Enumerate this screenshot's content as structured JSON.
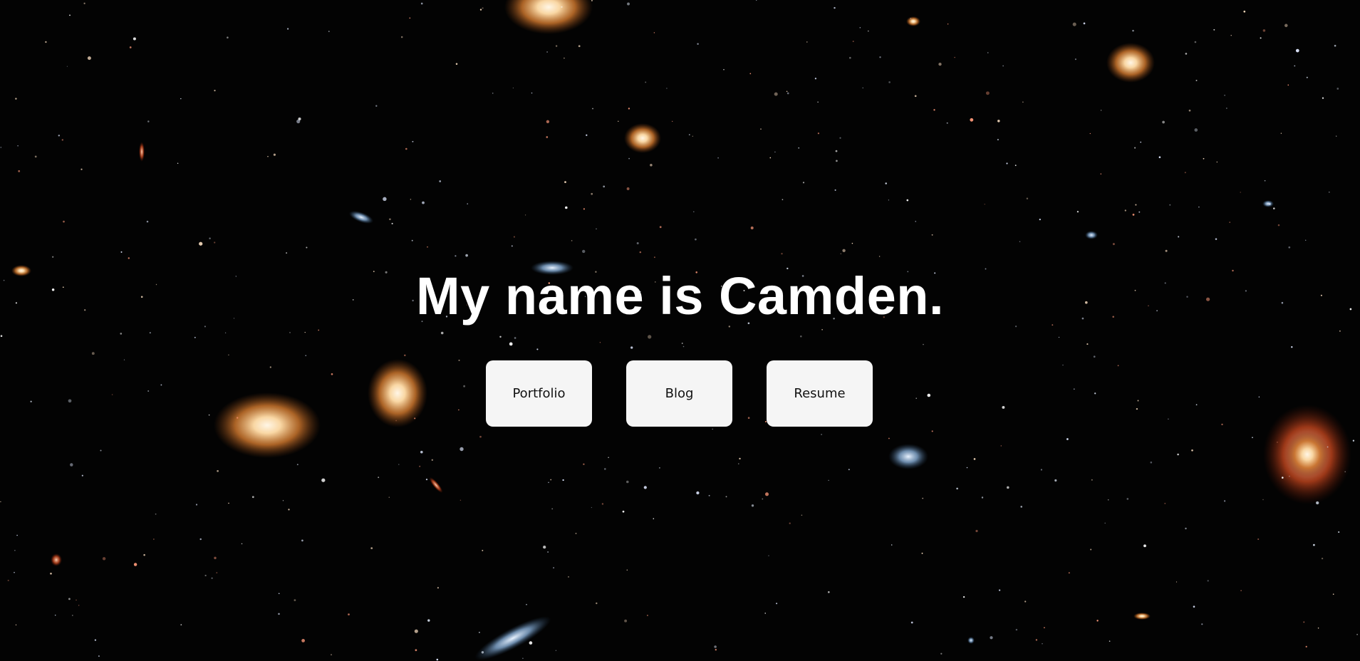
{
  "hero": {
    "headline": "My name is Camden."
  },
  "nav": {
    "items": [
      {
        "label": "Portfolio"
      },
      {
        "label": "Blog"
      },
      {
        "label": "Resume"
      }
    ]
  },
  "colors": {
    "background": "#030303",
    "headline": "#ffffff",
    "button_bg": "#f5f5f5",
    "button_text": "#111111"
  }
}
